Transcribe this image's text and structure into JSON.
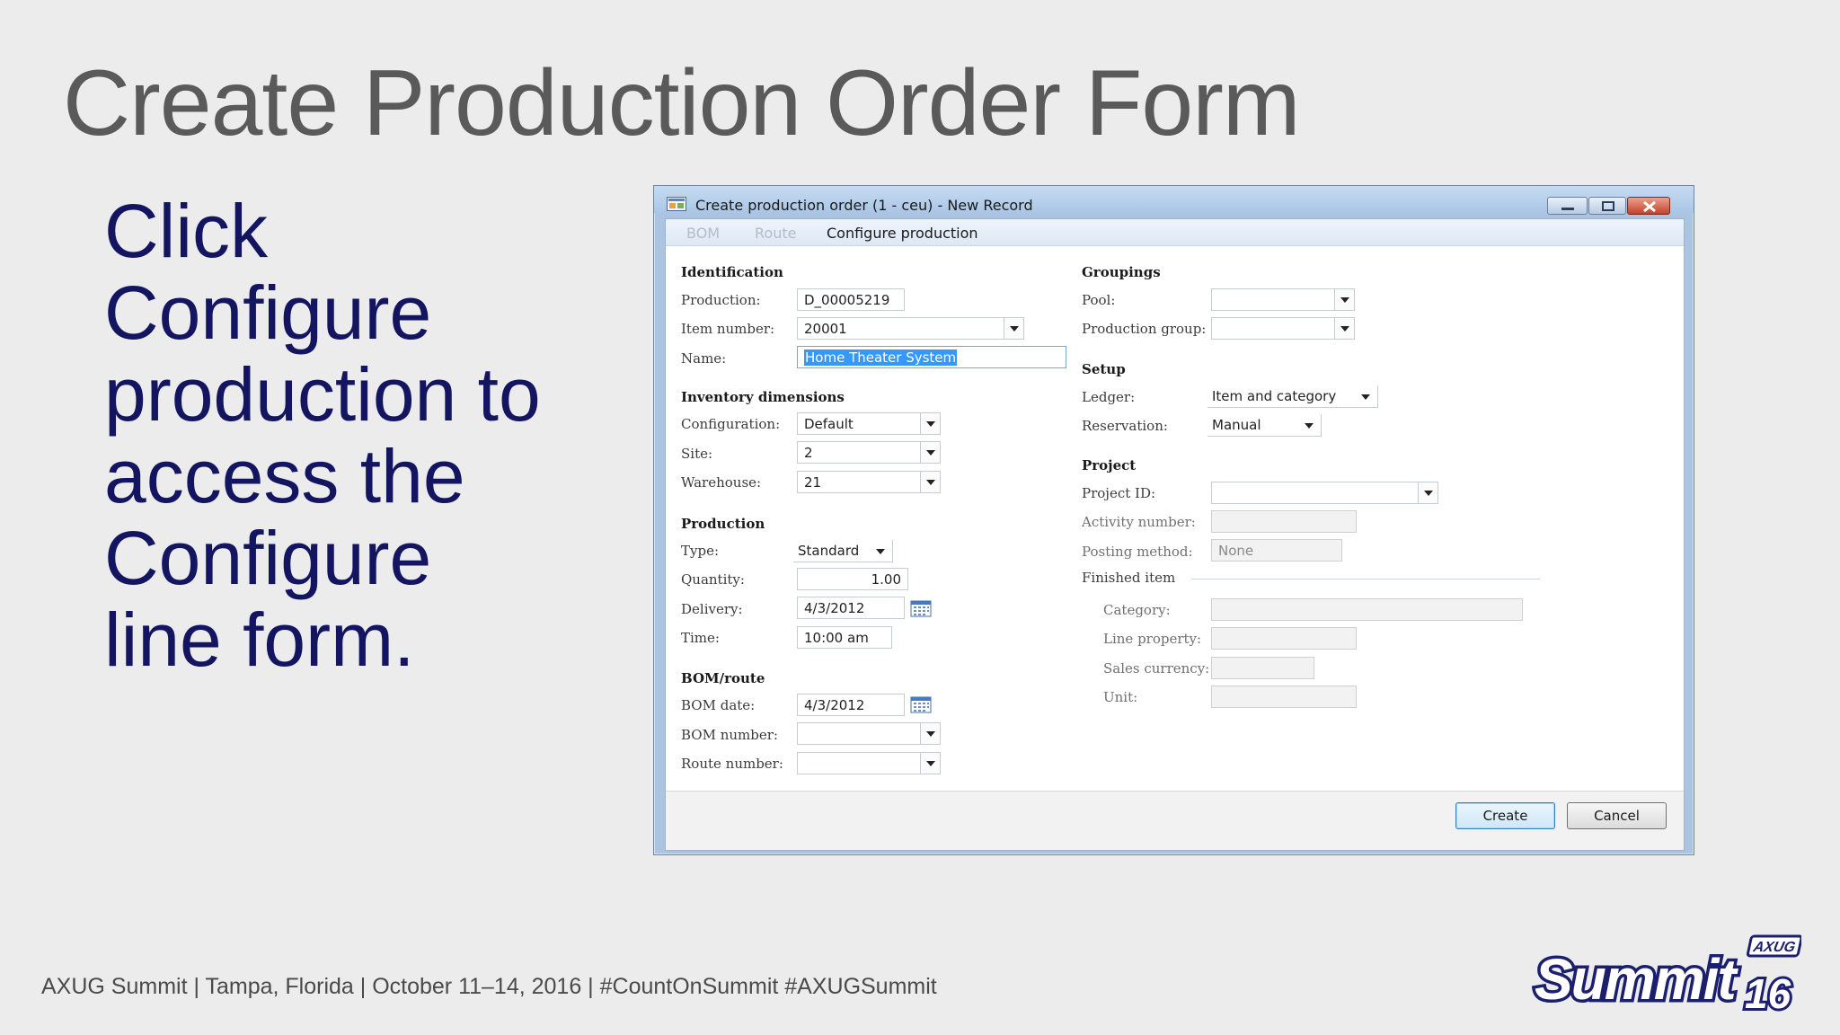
{
  "slide": {
    "title": "Create Production Order Form",
    "bullet_lines": [
      "Click",
      "Configure",
      "production to",
      "access the",
      "Configure",
      "line form."
    ],
    "footer": "AXUG Summit | Tampa, Florida | October 11–14, 2016 | #CountOnSummit  #AXUGSummit",
    "logo_badge": "AXUG",
    "logo_word": "Summit",
    "logo_year": "16"
  },
  "window": {
    "title": "Create production order (1 - ceu) - New Record",
    "menu": [
      {
        "label": "BOM",
        "state": "disabled"
      },
      {
        "label": "Route",
        "state": "disabled"
      },
      {
        "label": "Configure production",
        "state": "active"
      }
    ]
  },
  "form": {
    "identification": {
      "heading": "Identification",
      "production_label": "Production:",
      "production_value": "D_00005219",
      "item_label": "Item number:",
      "item_value": "20001",
      "name_label": "Name:",
      "name_value": "Home Theater System"
    },
    "inventory": {
      "heading": "Inventory dimensions",
      "config_label": "Configuration:",
      "config_value": "Default",
      "site_label": "Site:",
      "site_value": "2",
      "warehouse_label": "Warehouse:",
      "warehouse_value": "21"
    },
    "production": {
      "heading": "Production",
      "type_label": "Type:",
      "type_value": "Standard",
      "quantity_label": "Quantity:",
      "quantity_value": "1.00",
      "delivery_label": "Delivery:",
      "delivery_value": "4/3/2012",
      "time_label": "Time:",
      "time_value": "10:00 am"
    },
    "bom_route": {
      "heading": "BOM/route",
      "bom_date_label": "BOM date:",
      "bom_date_value": "4/3/2012",
      "bom_number_label": "BOM number:",
      "bom_number_value": "",
      "route_number_label": "Route number:",
      "route_number_value": ""
    },
    "groupings": {
      "heading": "Groupings",
      "pool_label": "Pool:",
      "pool_value": "",
      "group_label": "Production group:",
      "group_value": ""
    },
    "setup": {
      "heading": "Setup",
      "ledger_label": "Ledger:",
      "ledger_value": "Item and category",
      "reservation_label": "Reservation:",
      "reservation_value": "Manual"
    },
    "project": {
      "heading": "Project",
      "project_id_label": "Project ID:",
      "project_id_value": "",
      "activity_label": "Activity number:",
      "activity_value": "",
      "posting_label": "Posting method:",
      "posting_value": "None",
      "finished_heading": "Finished item",
      "category_label": "Category:",
      "category_value": "",
      "line_property_label": "Line property:",
      "line_property_value": "",
      "currency_label": "Sales currency:",
      "currency_value": "",
      "unit_label": "Unit:",
      "unit_value": ""
    }
  },
  "buttons": {
    "create": "Create",
    "cancel": "Cancel"
  }
}
